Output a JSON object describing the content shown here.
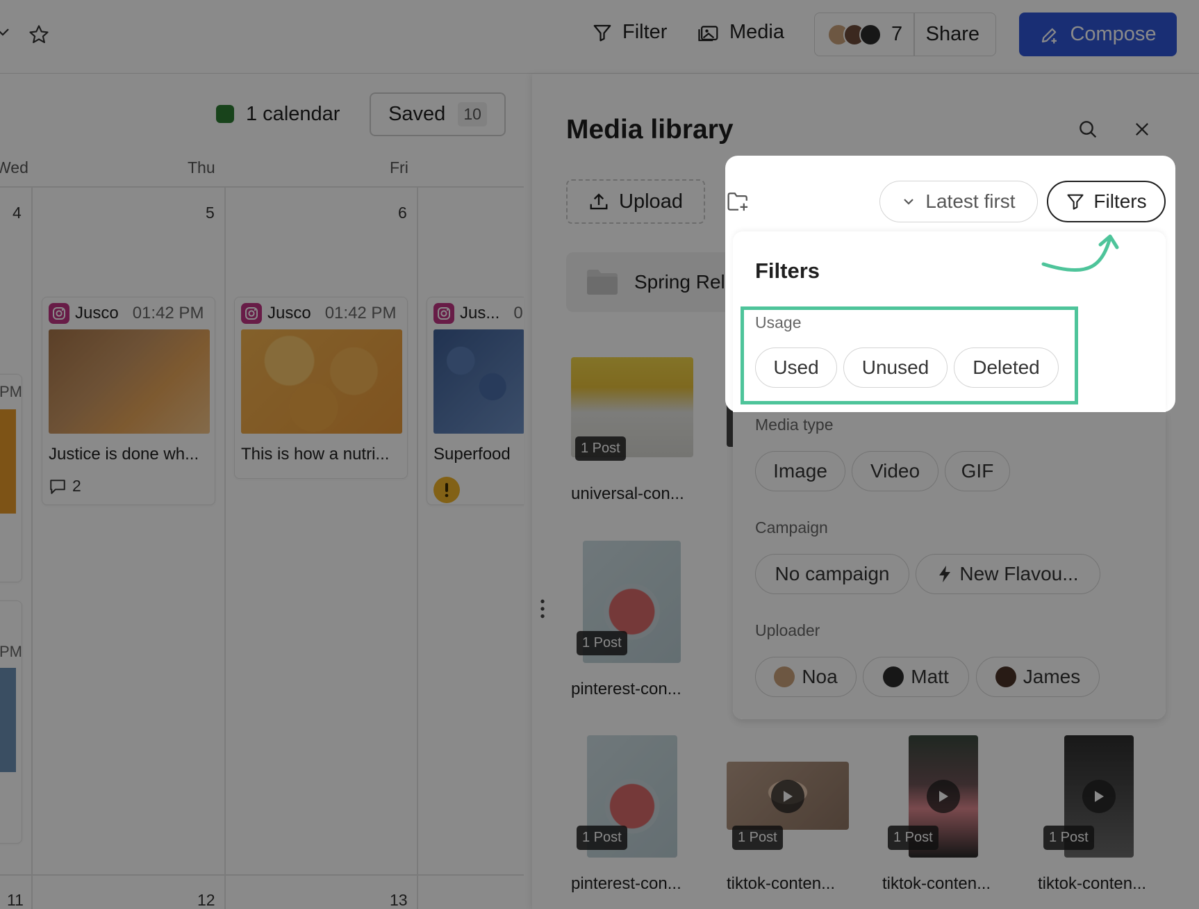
{
  "topbar": {
    "filter_label": "Filter",
    "media_label": "Media",
    "collaborator_count": "7",
    "share_label": "Share",
    "compose_label": "Compose"
  },
  "calendar": {
    "calendar_count_label": "1 calendar",
    "calendar_color": "#2e7d32",
    "saved_label": "Saved",
    "saved_count": "10",
    "day_labels": [
      "Wed",
      "Thu",
      "Fri"
    ],
    "week1_dates": [
      "4",
      "5",
      "6"
    ],
    "week2_dates": [
      "11",
      "12",
      "13"
    ],
    "side_time_labels": [
      "PM",
      "PM"
    ],
    "posts": [
      {
        "account": "Jusco",
        "time": "01:42 PM",
        "caption": "Justice is done wh...",
        "comments": "2"
      },
      {
        "account": "Jusco",
        "time": "01:42 PM",
        "caption": "This is how a nutri..."
      },
      {
        "account": "Jus...",
        "time": "0",
        "caption": "Superfood"
      }
    ]
  },
  "media_library": {
    "title": "Media library",
    "upload_label": "Upload",
    "folder_name": "Spring Rele",
    "sort_label": "Latest first",
    "filters_button_label": "Filters",
    "items": [
      {
        "name": "universal-con...",
        "usage": "1 Post",
        "type": "image"
      },
      {
        "name": "pinterest-con...",
        "usage": "1 Post",
        "type": "image"
      },
      {
        "name": "pinterest-con...",
        "usage": "1 Post",
        "type": "image"
      },
      {
        "name": "tiktok-conten...",
        "usage": "1 Post",
        "type": "video"
      },
      {
        "name": "tiktok-conten...",
        "usage": "1 Post",
        "type": "video"
      },
      {
        "name": "tiktok-conten...",
        "usage": "1 Post",
        "type": "video"
      }
    ]
  },
  "filters": {
    "title": "Filters",
    "usage": {
      "label": "Usage",
      "options": [
        "Used",
        "Unused",
        "Deleted"
      ]
    },
    "media_type": {
      "label": "Media type",
      "options": [
        "Image",
        "Video",
        "GIF"
      ]
    },
    "campaign": {
      "label": "Campaign",
      "options": [
        "No campaign",
        "New Flavou..."
      ]
    },
    "uploader": {
      "label": "Uploader",
      "options": [
        "Noa",
        "Matt",
        "James"
      ]
    },
    "highlight_color": "#4ec49a"
  },
  "colors": {
    "compose_button": "#2f56d6",
    "instagram": "#c13584",
    "warning": "#f0b429"
  },
  "icons": [
    "chevron-down-icon",
    "star-icon",
    "filter-icon",
    "media-icon",
    "compose-icon",
    "search-icon",
    "close-icon",
    "upload-icon",
    "new-folder-icon",
    "folder-icon",
    "instagram-icon",
    "comment-icon",
    "warning-icon",
    "play-icon",
    "lightning-icon",
    "more-vertical-icon",
    "arrow-annotation-icon"
  ]
}
